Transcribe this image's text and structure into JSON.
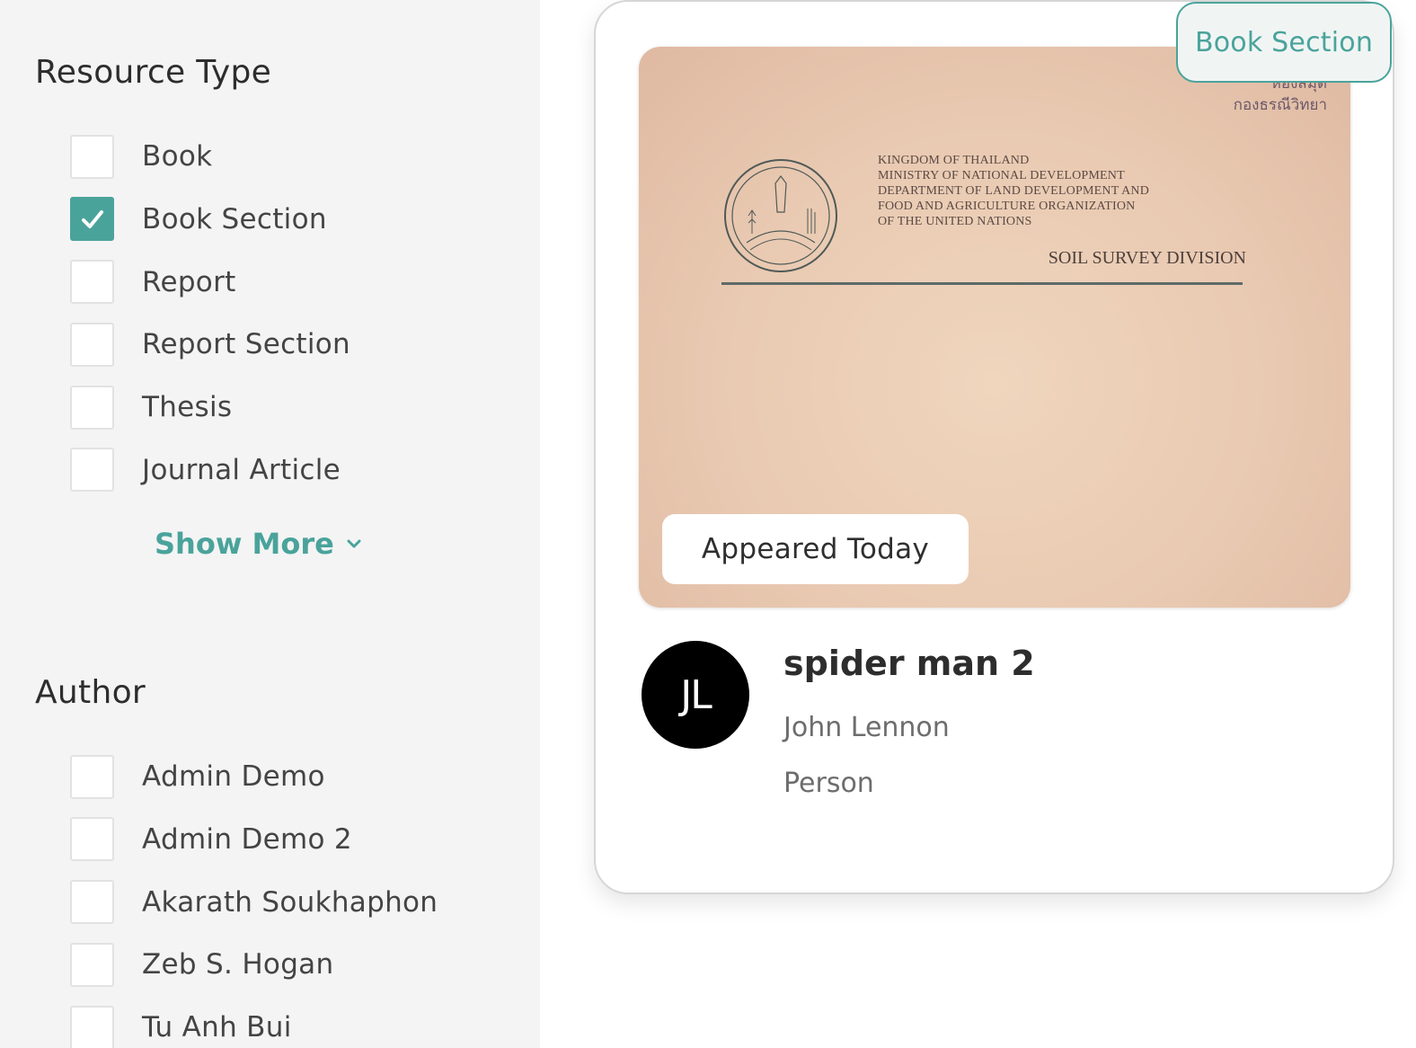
{
  "sidebar": {
    "resource_type": {
      "title": "Resource Type",
      "items": [
        {
          "label": "Book",
          "checked": false
        },
        {
          "label": "Book Section",
          "checked": true
        },
        {
          "label": "Report",
          "checked": false
        },
        {
          "label": "Report Section",
          "checked": false
        },
        {
          "label": "Thesis",
          "checked": false
        },
        {
          "label": "Journal Article",
          "checked": false
        }
      ],
      "show_more_label": "Show More"
    },
    "author": {
      "title": "Author",
      "items": [
        {
          "label": "Admin Demo",
          "checked": false
        },
        {
          "label": "Admin Demo 2",
          "checked": false
        },
        {
          "label": "Akarath Soukhaphon",
          "checked": false
        },
        {
          "label": "Zeb S. Hogan",
          "checked": false
        },
        {
          "label": "Tu Anh Bui",
          "checked": false
        }
      ]
    }
  },
  "card": {
    "type_badge": "Book Section",
    "cover": {
      "stamp_line1": "ห้องสมุด",
      "stamp_line2": "กองธรณีวิทยา",
      "heading_lines": [
        "KINGDOM OF THAILAND",
        "MINISTRY OF NATIONAL DEVELOPMENT",
        "DEPARTMENT OF LAND DEVELOPMENT  AND",
        "FOOD AND AGRICULTURE ORGANIZATION",
        "OF THE UNITED NATIONS"
      ],
      "division": "SOIL SURVEY DIVISION"
    },
    "appeared_badge": "Appeared Today",
    "avatar_initials": "JL",
    "title": "spider man 2",
    "author": "John Lennon",
    "role": "Person"
  },
  "colors": {
    "accent": "#4aa39b",
    "sidebar_bg": "#f4f4f4",
    "avatar_bg": "#000000"
  }
}
